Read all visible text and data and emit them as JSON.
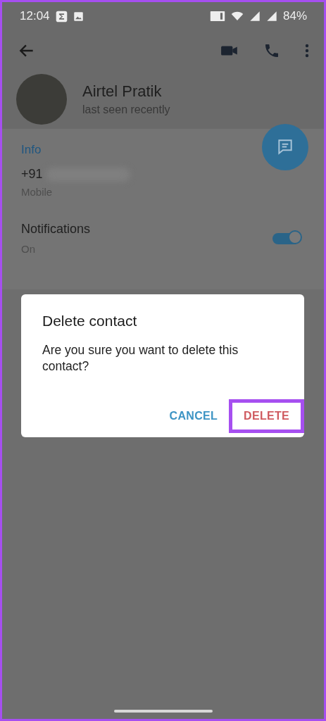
{
  "status_bar": {
    "time": "12:04",
    "battery": "84%"
  },
  "profile": {
    "name": "Airtel Pratik",
    "status": "last seen recently"
  },
  "info": {
    "section_title": "Info",
    "phone": "+91",
    "phone_hidden": true,
    "phone_label": "Mobile"
  },
  "notifications": {
    "title": "Notifications",
    "value": "On",
    "on": true
  },
  "dialog": {
    "title": "Delete contact",
    "message": "Are you sure you want to delete this contact?",
    "buttons": [
      {
        "label": "CANCEL",
        "kind": "neutral",
        "highlighted": false
      },
      {
        "label": "DELETE",
        "kind": "destructive",
        "highlighted": true
      }
    ]
  }
}
